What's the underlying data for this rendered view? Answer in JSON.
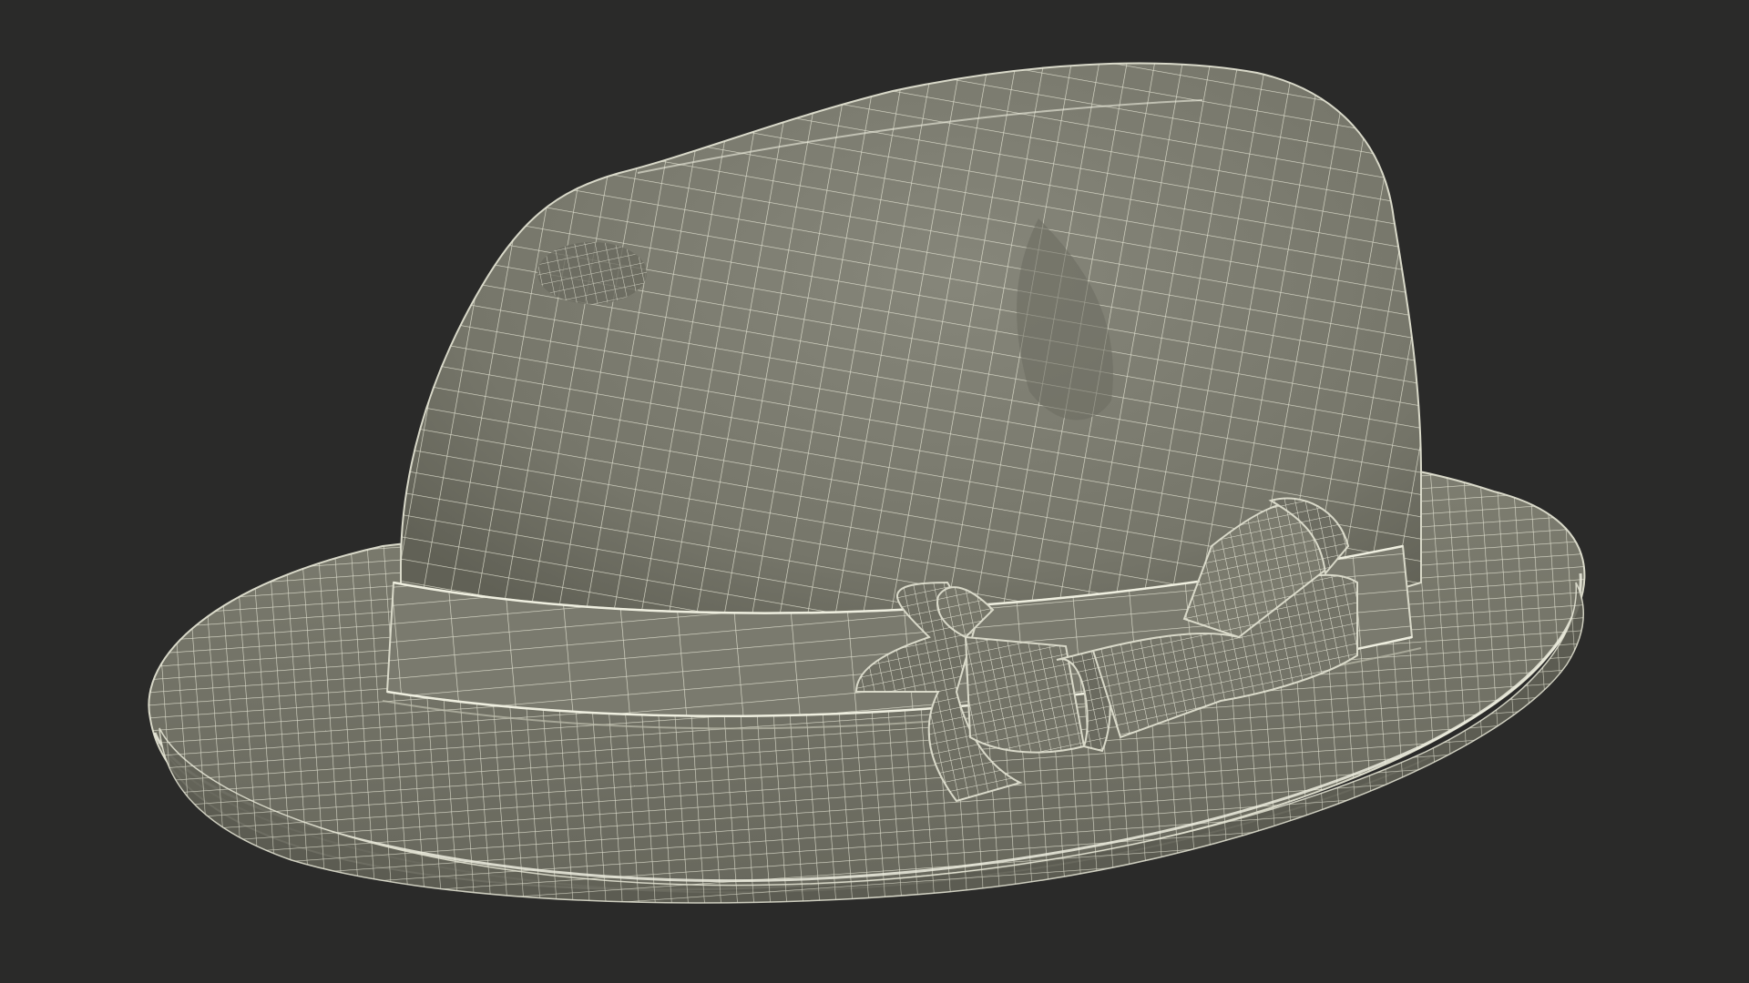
{
  "scene": {
    "subject": "fedora-hat-wireframe",
    "colors": {
      "background": "#2a2a29",
      "surface": "#7b7b6d",
      "surface_dark": "#5f5f54",
      "surface_light": "#8a8a7c",
      "wire": "#e8e8d8"
    }
  }
}
